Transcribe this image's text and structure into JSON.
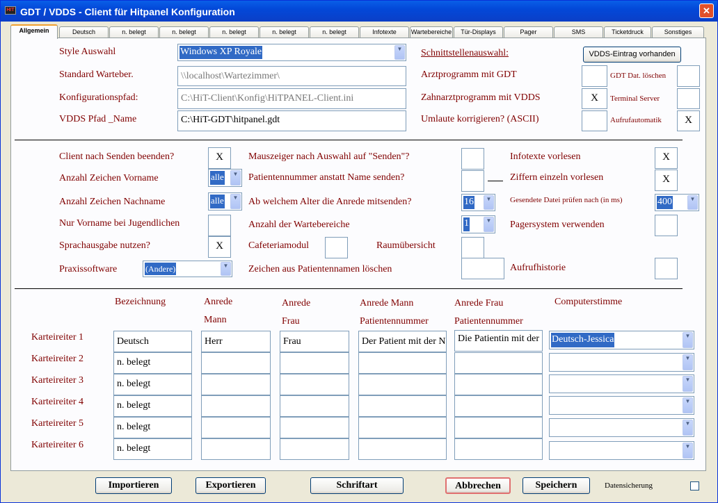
{
  "window": {
    "title": "GDT / VDDS - Client für Hitpanel  Konfiguration",
    "close": "✕",
    "icon_text": "HIT"
  },
  "tabs": [
    "Allgemein",
    "Deutsch",
    "n. belegt",
    "n. belegt",
    "n. belegt",
    "n. belegt",
    "n. belegt",
    "Infotexte",
    "Wartebereiche",
    "Tür-Displays",
    "Pager",
    "SMS",
    "Ticketdruck",
    "Sonstiges"
  ],
  "sec1": {
    "style_label": "Style Auswahl",
    "style_value": "Windows XP Royale",
    "warte_label": "Standard Warteber.",
    "warte_value": "\\\\localhost\\Wartezimmer\\",
    "konfig_label": "Konfigurationspfad:",
    "konfig_value": "C:\\HiT-Client\\Konfig\\HiTPANEL-Client.ini",
    "vdds_label": "VDDS Pfad _Name",
    "vdds_value": "C:\\HiT-GDT\\hitpanel.gdt",
    "schnitt_label": "Schnittstellenauswahl:",
    "vdds_button": "VDDS-Eintrag vorhanden",
    "arzt_label": "Arztprogramm mit GDT",
    "arzt_val": "",
    "zahn_label": "Zahnarztprogramm mit VDDS",
    "zahn_val": "X",
    "umlaute_label": "Umlaute korrigieren? (ASCII)",
    "umlaute_val": "",
    "gdtdel_label": "GDT Dat. löschen",
    "gdtdel_val": "",
    "terminal_label": "Terminal Server",
    "terminal_val": "",
    "aufruf_label": "Aufrufautomatik",
    "aufruf_val": "X"
  },
  "sec2": {
    "client_label": "Client nach Senden beenden?",
    "client_val": "X",
    "vorname_label": "Anzahl Zeichen Vorname",
    "vorname_val": "alle",
    "nachname_label": "Anzahl Zeichen Nachname",
    "nachname_val": "alle",
    "jugend_label": "Nur Vorname bei Jugendlichen",
    "jugend_val": "",
    "sprach_label": "Sprachausgabe nutzen?",
    "sprach_val": "X",
    "praxis_label": "Praxissoftware",
    "praxis_val": "(Andere)",
    "maus_label": "Mauszeiger nach Auswahl auf \"Senden\"?",
    "maus_val": "",
    "patnr_label": "Patientennummer anstatt Name senden?",
    "patnr_val": "",
    "alter_label": "Ab welchem Alter die Anrede mitsenden?",
    "alter_val": "16",
    "wb_label": "Anzahl der Wartebereiche",
    "wb_val": "1",
    "cafe_label": "Cafeteriamodul",
    "cafe_val": "",
    "raum_label": "Raumübersicht",
    "raum_val": "",
    "zeichen_label": "Zeichen aus Patientennamen löschen",
    "zeichen_val": "",
    "info_label": "Infotexte vorlesen",
    "info_val": "X",
    "ziffern_label": "Ziffern einzeln vorlesen",
    "ziffern_val": "X",
    "datei_label": "Gesendete Datei prüfen nach (in ms)",
    "datei_val": "400",
    "pager_label": "Pagersystem verwenden",
    "pager_val": "",
    "hist_label": "Aufrufhistorie",
    "hist_val": ""
  },
  "sec3": {
    "headers": {
      "bez": "Bezeichnung",
      "am1": "Anrede",
      "am2": "Mann",
      "af1": "Anrede",
      "af2": "Frau",
      "apm1": "Anrede Mann",
      "apm2": "Patientennummer",
      "apf1": "Anrede Frau",
      "apf2": "Patientennummer",
      "voice": "Computerstimme"
    },
    "rows": [
      {
        "label": "Karteireiter 1",
        "bez": "Deutsch",
        "mann": "Herr",
        "frau": "Frau",
        "pm": "Der Patient mit der N",
        "pf": "Die Patientin mit der",
        "voice": "Deutsch-Jessica"
      },
      {
        "label": "Karteireiter 2",
        "bez": "n. belegt",
        "mann": "",
        "frau": "",
        "pm": "",
        "pf": "",
        "voice": ""
      },
      {
        "label": "Karteireiter 3",
        "bez": "n. belegt",
        "mann": "",
        "frau": "",
        "pm": "",
        "pf": "",
        "voice": ""
      },
      {
        "label": "Karteireiter 4",
        "bez": "n. belegt",
        "mann": "",
        "frau": "",
        "pm": "",
        "pf": "",
        "voice": ""
      },
      {
        "label": "Karteireiter 5",
        "bez": "n. belegt",
        "mann": "",
        "frau": "",
        "pm": "",
        "pf": "",
        "voice": ""
      },
      {
        "label": "Karteireiter 6",
        "bez": "n. belegt",
        "mann": "",
        "frau": "",
        "pm": "",
        "pf": "",
        "voice": ""
      }
    ]
  },
  "buttons": {
    "import": "Importieren",
    "export": "Exportieren",
    "font": "Schriftart",
    "cancel": "Abbrechen",
    "save": "Speichern",
    "datasave": "Datensicherung"
  }
}
